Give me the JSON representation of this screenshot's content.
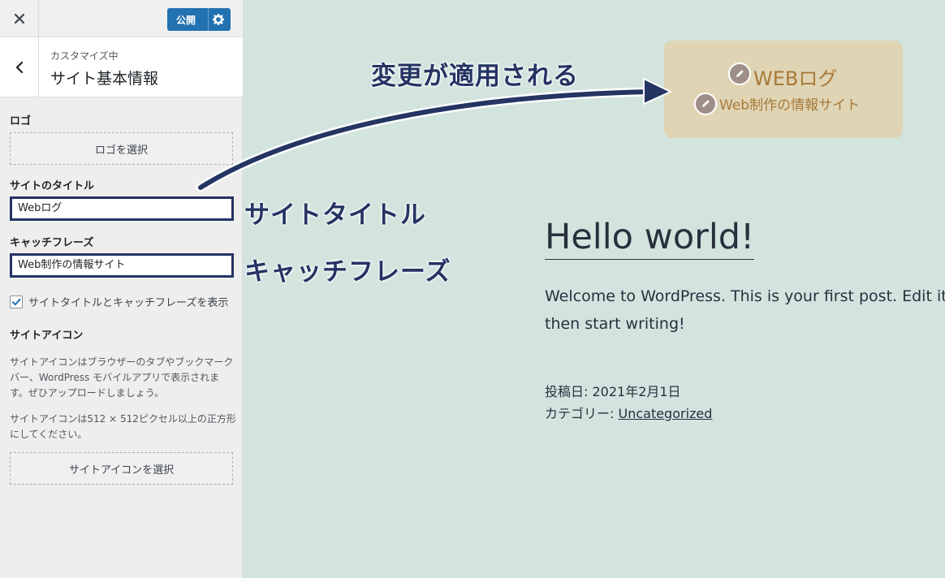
{
  "topbar": {
    "publish_label": "公開"
  },
  "section": {
    "crumb": "カスタマイズ中",
    "title": "サイト基本情報"
  },
  "logo": {
    "label": "ロゴ",
    "button": "ロゴを選択"
  },
  "site_title": {
    "label": "サイトのタイトル",
    "value": "Webログ"
  },
  "tagline": {
    "label": "キャッチフレーズ",
    "value": "Web制作の情報サイト"
  },
  "display_checkbox": {
    "label": "サイトタイトルとキャッチフレーズを表示",
    "checked": true
  },
  "site_icon": {
    "label": "サイトアイコン",
    "desc1": "サイトアイコンはブラウザーのタブやブックマークバー、WordPress モバイルアプリで表示されます。ぜひアップロードしましょう。",
    "desc2": "サイトアイコンは512 × 512ピクセル以上の正方形にしてください。",
    "button": "サイトアイコンを選択"
  },
  "annotations": {
    "applied": "変更が適用される",
    "site_title": "サイトタイトル",
    "tagline": "キャッチフレーズ"
  },
  "preview": {
    "site_title": "WEBログ",
    "tagline": "Web制作の情報サイト",
    "post_title": "Hello world!",
    "post_body": "Welcome to WordPress. This is your first post. Edit it, then start writing!",
    "posted_on": "投稿日: 2021年2月1日",
    "category_label": "カテゴリー: ",
    "category": "Uncategorized"
  },
  "colors": {
    "accent": "#2271b1",
    "annotation": "#243463",
    "preview_bg": "#d3e4df",
    "header_box": "#dfd4b4"
  }
}
